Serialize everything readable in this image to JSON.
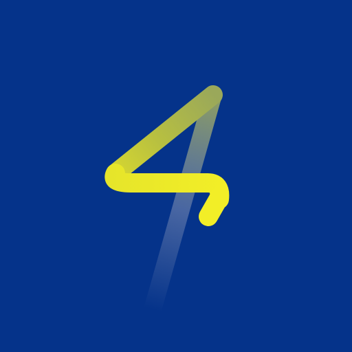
{
  "logo": {
    "icon": "number-four-stroke-logo-icon",
    "colors": {
      "background": "#05338A",
      "stroke_primary": "#F2EE27",
      "stroke_secondary": "#9AA85A",
      "trail": "#7F8FB6"
    }
  }
}
